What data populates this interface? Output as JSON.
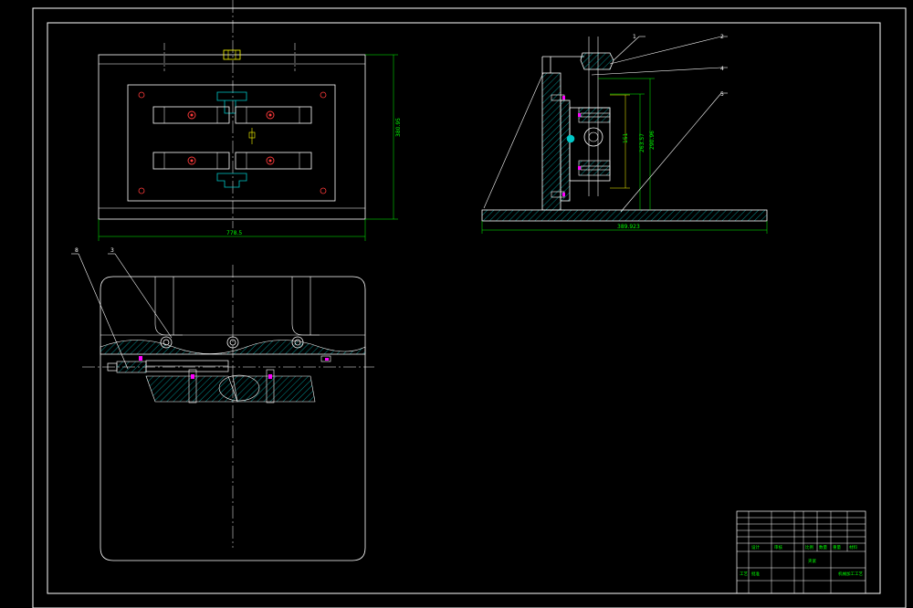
{
  "drawing": {
    "colors": {
      "background": "#000000",
      "outline": "#ffffff",
      "dimension": "#00ff00",
      "section_hatch": "#00c8c8",
      "screw_mark": "#ff3a3a",
      "highlight": "#ffff00",
      "magenta": "#ff00ff"
    },
    "top_view": {
      "width_dim": "778.5",
      "height_dim": "380.95"
    },
    "side_view": {
      "base_dim": "389.923",
      "height_dim_1": "290.96",
      "height_dim_2": "263.57",
      "height_dim_3": "151"
    },
    "leaders": {
      "front_1": "8",
      "front_2": "3",
      "side_1": "1",
      "side_2": "2",
      "side_3": "4",
      "side_4": "5"
    },
    "title_block": {
      "drawing_name": "夹紧",
      "company": "机械加工工艺",
      "labels": [
        "设计",
        "审核",
        "工艺",
        "批准",
        "比例",
        "数量",
        "重量",
        "材料"
      ]
    }
  }
}
